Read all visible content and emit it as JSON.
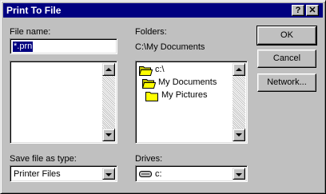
{
  "window": {
    "title": "Print To File",
    "help_label": "?",
    "close_label": "✕"
  },
  "filename": {
    "label": "File name:",
    "value": "*.prn"
  },
  "folders": {
    "label": "Folders:",
    "current_path": "C:\\My Documents",
    "tree": [
      {
        "label": "c:\\",
        "icon": "folder-open-icon"
      },
      {
        "label": "My Documents",
        "icon": "folder-open-icon"
      },
      {
        "label": "My Pictures",
        "icon": "folder-icon"
      }
    ]
  },
  "file_type": {
    "label": "Save file as type:",
    "value": "Printer Files"
  },
  "drives": {
    "label": "Drives:",
    "value": "c:",
    "icon": "hard-drive-icon"
  },
  "buttons": {
    "ok": "OK",
    "cancel": "Cancel",
    "network": "Network..."
  },
  "colors": {
    "titlebar": "#000080",
    "face": "#c0c0c0",
    "selection": "#000080",
    "folder": "#ffff00"
  }
}
